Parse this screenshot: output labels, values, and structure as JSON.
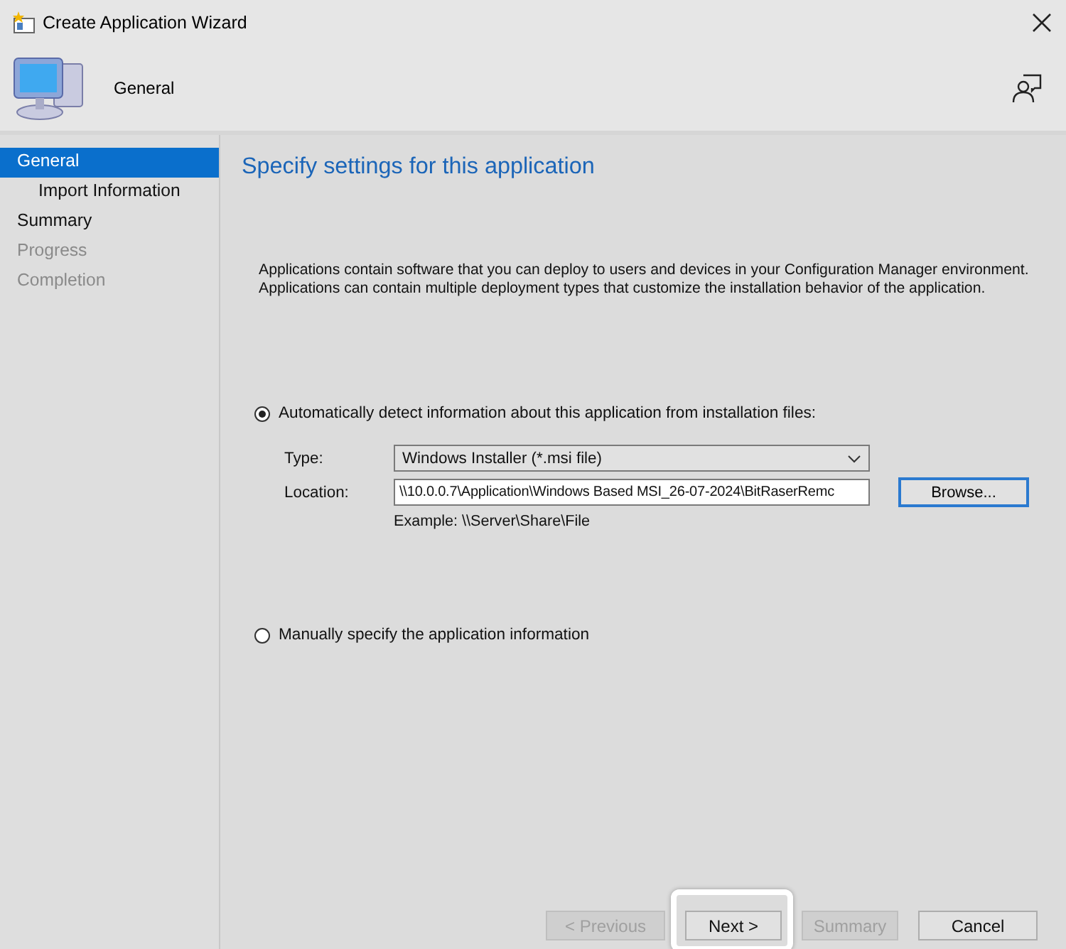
{
  "window": {
    "title": "Create Application Wizard"
  },
  "header": {
    "title": "General"
  },
  "sidebar": {
    "items": [
      {
        "label": "General",
        "selected": true,
        "disabled": false,
        "children": [
          {
            "label": "Import Information",
            "selected": false,
            "disabled": false
          }
        ]
      },
      {
        "label": "Summary",
        "selected": false,
        "disabled": false
      },
      {
        "label": "Progress",
        "selected": false,
        "disabled": true
      },
      {
        "label": "Completion",
        "selected": false,
        "disabled": true
      }
    ]
  },
  "page": {
    "heading": "Specify settings for this application",
    "description": [
      "Applications contain software that you can deploy to users and devices in your Configuration Manager environment.",
      "Applications can contain multiple deployment types that customize the installation behavior of the application."
    ],
    "options": [
      {
        "label": "Automatically detect information about this application from installation files:",
        "selected": true
      },
      {
        "label": "Manually specify the application information",
        "selected": false
      }
    ],
    "type": {
      "label": "Type:",
      "value": "Windows Installer (*.msi file)"
    },
    "location": {
      "label": "Location:",
      "value": "\\\\10.0.0.7\\Application\\Windows Based MSI_26-07-2024\\BitRaserRemc"
    },
    "browse": "Browse...",
    "example": "Example: \\\\Server\\Share\\File"
  },
  "buttons": [
    {
      "label": "< Previous",
      "disabled": true,
      "highlighted": false
    },
    {
      "label": "Next >",
      "disabled": false,
      "highlighted": true
    },
    {
      "label": "Summary",
      "disabled": true,
      "highlighted": false
    },
    {
      "label": "Cancel",
      "disabled": false,
      "highlighted": false
    }
  ]
}
